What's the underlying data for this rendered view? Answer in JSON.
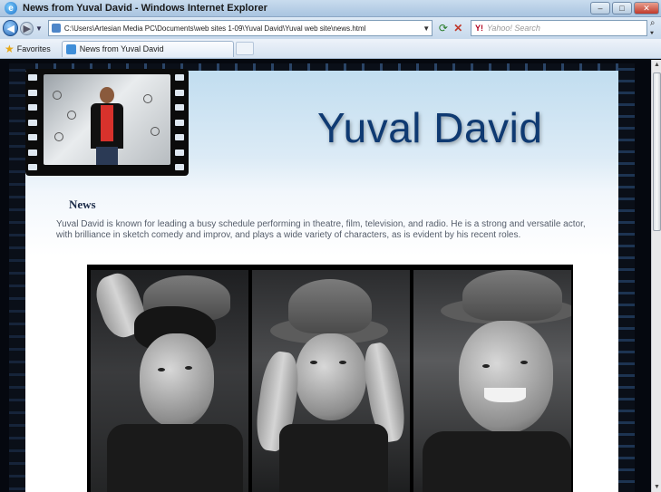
{
  "window": {
    "title": "News from Yuval David - Windows Internet Explorer",
    "ie_icon": "ie-logo-icon",
    "buttons": {
      "minimize": "–",
      "maximize": "□",
      "close": "✕"
    }
  },
  "toolbar": {
    "back_icon": "back-arrow-icon",
    "forward_icon": "forward-arrow-icon",
    "address": "C:\\Users\\Artesian Media PC\\Documents\\web sites 1-09\\Yuval David\\Yuval web site\\news.html",
    "search_placeholder": "Yahoo! Search",
    "search_logo": "Y!"
  },
  "favorites_bar": {
    "favorites_label": "Favorites",
    "tab_label": "News from Yuval David"
  },
  "page": {
    "site_title": "Yuval David",
    "section_heading": "News",
    "intro": "Yuval David is known for leading a busy schedule performing in theatre, film, television, and radio. He is a strong and versatile actor, with brilliance in sketch comedy and improv, and plays a wide variety of characters, as is evident by his recent roles.",
    "header_photo_alt": "yuval-headshot",
    "photo_strip_alt": "three-portraits-in-fedora"
  },
  "colors": {
    "title_blue": "#0f3a72",
    "heading": "#1b2a47",
    "body_text": "#555d6a"
  }
}
